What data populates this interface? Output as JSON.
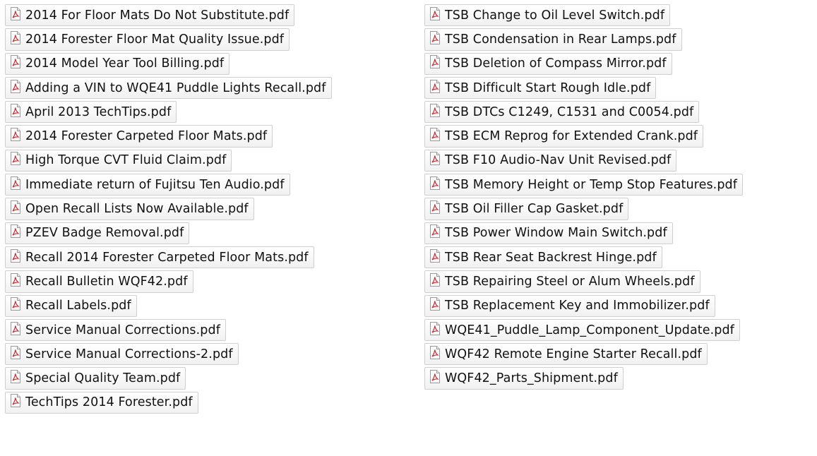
{
  "files_left": [
    "2014 For Floor Mats Do Not Substitute.pdf",
    "2014 Forester Floor Mat Quality Issue.pdf",
    "2014 Model Year Tool Billing.pdf",
    "Adding a VIN to WQE41 Puddle Lights Recall.pdf",
    "April 2013 TechTips.pdf",
    "2014 Forester Carpeted Floor Mats.pdf",
    "High Torque CVT Fluid Claim.pdf",
    "Immediate return of Fujitsu Ten Audio.pdf",
    "Open Recall Lists Now Available.pdf",
    "PZEV Badge Removal.pdf",
    "Recall 2014 Forester Carpeted Floor Mats.pdf",
    "Recall Bulletin WQF42.pdf",
    "Recall Labels.pdf",
    "Service Manual Corrections.pdf",
    "Service Manual Corrections-2.pdf",
    "Special Quality  Team.pdf",
    "TechTips 2014 Forester.pdf"
  ],
  "files_right": [
    "TSB Change to Oil Level Switch.pdf",
    "TSB Condensation in Rear Lamps.pdf",
    "TSB Deletion of Compass Mirror.pdf",
    "TSB Difficult Start Rough Idle.pdf",
    "TSB DTCs C1249, C1531 and C0054.pdf",
    "TSB ECM Reprog for Extended Crank.pdf",
    "TSB F10 Audio-Nav Unit Revised.pdf",
    "TSB Memory Height or Temp Stop Features.pdf",
    "TSB Oil Filler Cap Gasket.pdf",
    "TSB Power Window Main Switch.pdf",
    "TSB Rear Seat Backrest Hinge.pdf",
    "TSB Repairing Steel or Alum Wheels.pdf",
    "TSB Replacement Key and Immobilizer.pdf",
    "WQE41_Puddle_Lamp_Component_Update.pdf",
    "WQF42 Remote Engine Starter Recall.pdf",
    "WQF42_Parts_Shipment.pdf"
  ],
  "icon": "pdf-file-icon",
  "colors": {
    "icon_accent": "#c8262c",
    "item_border": "#cfcfcf"
  }
}
